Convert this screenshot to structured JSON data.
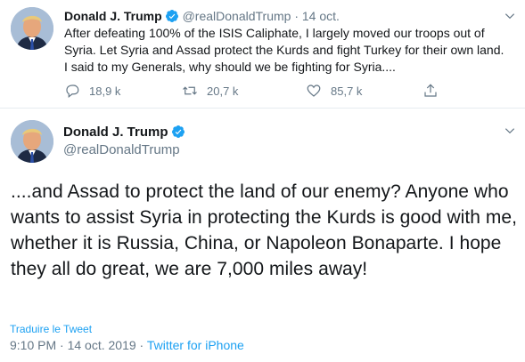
{
  "tweet1": {
    "name": "Donald J. Trump",
    "handle": "@realDonaldTrump",
    "separator": "·",
    "date": "14 oct.",
    "text": "After defeating 100% of the ISIS Caliphate, I largely moved our troops out of Syria. Let Syria and Assad protect the Kurds and fight Turkey for their own land. I said to my Generals, why should we be fighting for Syria....",
    "replies": "18,9 k",
    "retweets": "20,7 k",
    "likes": "85,7 k"
  },
  "tweet2": {
    "name": "Donald J. Trump",
    "handle": "@realDonaldTrump",
    "text": "....and Assad to protect the land of our enemy? Anyone who wants to assist Syria in protecting the Kurds is good with me, whether it is Russia, China, or Napoleon Bonaparte. I hope they all do great, we are 7,000 miles away!",
    "translate_label": "Traduire le Tweet",
    "time": "9:10 PM",
    "dot": "·",
    "full_date": "14 oct. 2019",
    "source": "Twitter for iPhone"
  },
  "icons": [
    "verified-icon",
    "chevron-down-icon",
    "reply-icon",
    "retweet-icon",
    "like-icon",
    "share-icon"
  ],
  "colors": {
    "accent": "#1da1f2",
    "muted": "#657786",
    "text": "#14171a",
    "border": "#e6ecf0"
  }
}
